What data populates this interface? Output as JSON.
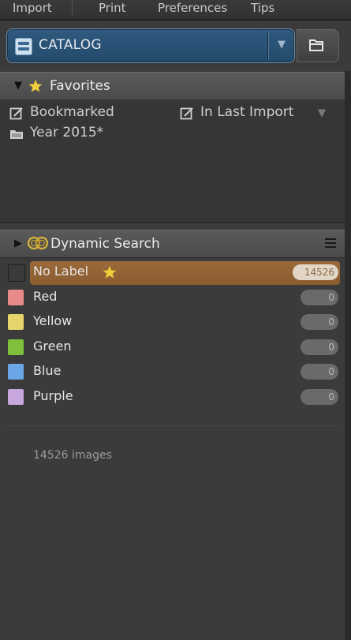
{
  "menu": {
    "items": [
      "Import",
      "Print",
      "Preferences",
      "Tips"
    ]
  },
  "catalog": {
    "label": "CATALOG",
    "dropdown_icon": "chevron-down-icon",
    "folder_icon": "folder-icon"
  },
  "favorites": {
    "title": "Favorites",
    "expanded": true,
    "items": [
      {
        "label": "Bookmarked",
        "icon": "edit-icon"
      },
      {
        "label": "In Last Import",
        "icon": "edit-icon"
      },
      {
        "label": "Year 2015*",
        "icon": "folder-icon"
      }
    ]
  },
  "dynamic_search": {
    "title": "Dynamic Search",
    "expanded": false,
    "menu_icon": "hamburger-icon",
    "labels": [
      {
        "label": "No Label",
        "count": "14526",
        "color": "#3a3a3a",
        "starred": true,
        "selected": true
      },
      {
        "label": "Red",
        "count": "0",
        "color": "#e88a8a",
        "starred": false,
        "selected": false
      },
      {
        "label": "Yellow",
        "count": "0",
        "color": "#e6d36a",
        "starred": false,
        "selected": false
      },
      {
        "label": "Green",
        "count": "0",
        "color": "#7ec03a",
        "starred": false,
        "selected": false
      },
      {
        "label": "Blue",
        "count": "0",
        "color": "#6aa6e6",
        "starred": false,
        "selected": false
      },
      {
        "label": "Purple",
        "count": "0",
        "color": "#c8a6de",
        "starred": false,
        "selected": false
      }
    ]
  },
  "status": {
    "image_count": "14526 images"
  },
  "colors": {
    "accent_selected": "#8a5c30",
    "star": "#e6c23a",
    "catalog_blue": "#2f5a7e"
  }
}
